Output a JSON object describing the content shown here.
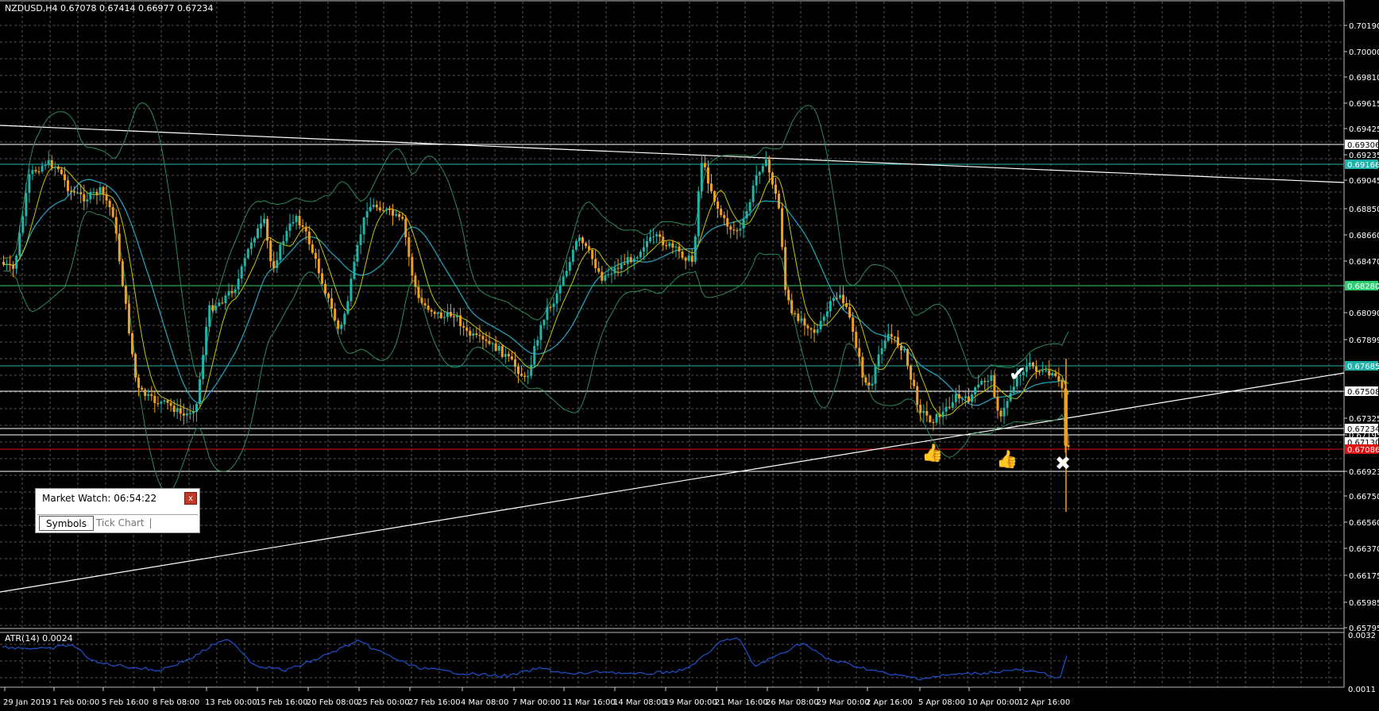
{
  "header": {
    "symbol_info": "NZDUSD,H4  0.67078 0.67414 0.66977 0.67234"
  },
  "price_axis": {
    "labels": [
      "0.70190",
      "0.70000",
      "0.69810",
      "0.69615",
      "0.69425",
      "0.69235",
      "0.69045",
      "0.68850",
      "0.68660",
      "0.68470",
      "0.68280",
      "0.68090",
      "0.67899",
      "0.67705",
      "0.67325",
      "0.67195",
      "0.66923",
      "0.66750",
      "0.66560",
      "0.66370",
      "0.66175",
      "0.65985",
      "0.65795"
    ],
    "tags": [
      {
        "text": "0.69306",
        "color": "#ffffff",
        "text_color": "#000000"
      },
      {
        "text": "0.69166",
        "color": "#20b2aa",
        "text_color": "#ffffff"
      },
      {
        "text": "0.68280",
        "color": "#2ecc71",
        "text_color": "#ffffff"
      },
      {
        "text": "0.67685",
        "color": "#20b2aa",
        "text_color": "#ffffff"
      },
      {
        "text": "0.67508",
        "color": "#ffffff",
        "text_color": "#000000"
      },
      {
        "text": "0.67234",
        "color": "#ffffff",
        "text_color": "#000000"
      },
      {
        "text": "0.67130",
        "color": "#ffffff",
        "text_color": "#000000"
      },
      {
        "text": "0.67086",
        "color": "#e01010",
        "text_color": "#ffffff"
      }
    ]
  },
  "time_axis": {
    "labels": [
      "29 Jan 2019",
      "1 Feb 00:00",
      "5 Feb 16:00",
      "8 Feb 08:00",
      "13 Feb 00:00",
      "15 Feb 16:00",
      "20 Feb 08:00",
      "25 Feb 00:00",
      "27 Feb 16:00",
      "4 Mar 08:00",
      "7 Mar 00:00",
      "11 Mar 16:00",
      "14 Mar 08:00",
      "19 Mar 00:00",
      "21 Mar 16:00",
      "26 Mar 08:00",
      "29 Mar 00:00",
      "2 Apr 16:00",
      "5 Apr 08:00",
      "10 Apr 00:00",
      "12 Apr 16:00"
    ]
  },
  "indicator": {
    "label": "ATR(14) 0.0024",
    "axis_labels": [
      "0.0032",
      "0.0011"
    ]
  },
  "market_watch": {
    "title": "Market Watch: 06:54:22",
    "close_label": "x",
    "tabs": [
      "Symbols",
      "Tick Chart"
    ]
  },
  "colors": {
    "background": "#000000",
    "grid": "#5a5a5a",
    "bull_candle": "#1fb5a8",
    "bear_candle": "#f0a020",
    "bollinger": "#2e8b57",
    "ma_fast": "#c8c800",
    "ma_slow": "#20a0c0",
    "atr_line": "#2050d0"
  }
}
